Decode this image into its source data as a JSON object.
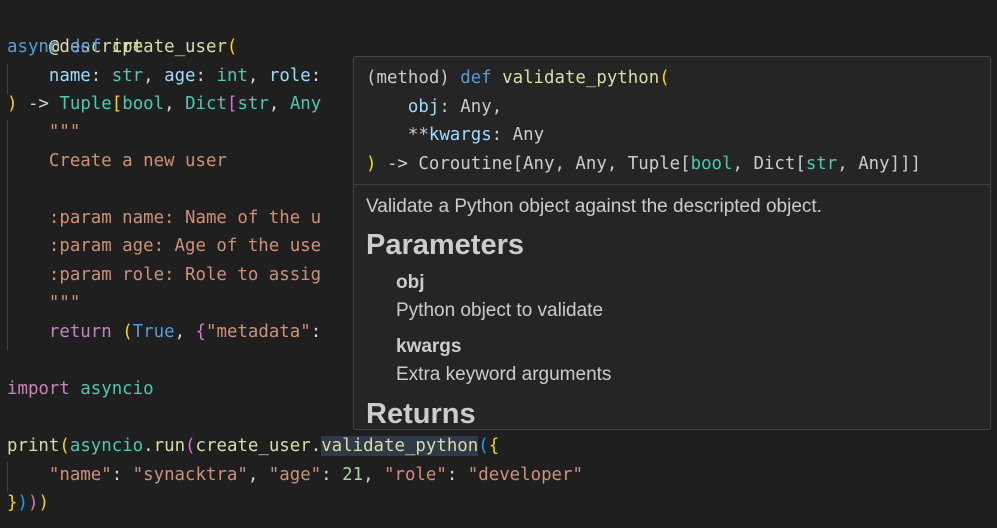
{
  "editor": {
    "decorator": "@descript",
    "l2": {
      "kw_async": "async",
      "kw_def": "def",
      "fn_name": "create_user",
      "open": "("
    },
    "l3": {
      "p1": "name",
      "c1": ": ",
      "t1": "str",
      "s1": ", ",
      "p2": "age",
      "c2": ": ",
      "t2": "int",
      "s2": ", ",
      "p3": "role",
      "c3": ":"
    },
    "l4": {
      "close": ")",
      "arrow": " -> ",
      "t_tuple": "Tuple",
      "lb": "[",
      "t_bool": "bool",
      "sep": ", ",
      "t_dict": "Dict",
      "lb2": "[",
      "t_str": "str",
      "sep2": ", ",
      "t_any": "Any"
    },
    "doc_open": "\"\"\"",
    "doc_line1": "Create a new user",
    "doc_param1": ":param name: Name of the u",
    "doc_param2": ":param age: Age of the use",
    "doc_param3": ":param role: Role to assig",
    "doc_close": "\"\"\"",
    "ret": {
      "kw": "return",
      "sp": " ",
      "po": "(",
      "true": "True",
      "sep": ", ",
      "bo": "{",
      "key": "\"metadata\"",
      "colon": ":"
    },
    "imp": {
      "kw": "import",
      "mod": " asyncio"
    },
    "print": {
      "fn": "print",
      "p1": "(",
      "mod": "asyncio",
      "dot": ".",
      "run": "run",
      "p2": "(",
      "cu": "create_user",
      "dot2": ".",
      "vp": "validate_python",
      "p3": "(",
      "brace": "{"
    },
    "dict_line": {
      "k1": "\"name\"",
      "c1": ": ",
      "v1": "\"synacktra\"",
      "s1": ", ",
      "k2": "\"age\"",
      "c2": ": ",
      "v2": "21",
      "s2": ", ",
      "k3": "\"role\"",
      "c3": ": ",
      "v3": "\"developer\""
    },
    "end": {
      "b": "}",
      "p3": ")",
      "p2": ")",
      "p1": ")"
    }
  },
  "hover": {
    "sig1": {
      "tag": "(method) ",
      "kw": "def",
      "name": " validate_python",
      "open": "("
    },
    "sig2": {
      "indent": "    ",
      "param": "obj",
      "colon": ": ",
      "type": "Any",
      "comma": ","
    },
    "sig3": {
      "indent": "    ",
      "stars": "**",
      "param": "kwargs",
      "colon": ": ",
      "type": "Any"
    },
    "sig4": {
      "close": ")",
      "arrow": " -> ",
      "coro": "Coroutine",
      "rest": "[Any, Any, Tuple[",
      "bool": "bool",
      "sep": ", ",
      "dict": "Dict",
      "lb": "[",
      "str": "str",
      "tail": ", Any]]]"
    },
    "description": "Validate a Python object against the descripted object.",
    "params_heading": "Parameters",
    "params": [
      {
        "name": "obj",
        "desc": "Python object to validate"
      },
      {
        "name": "kwargs",
        "desc": "Extra keyword arguments"
      }
    ],
    "returns_heading": "Returns"
  },
  "colors": {
    "background": "#1f1f1f",
    "keyword": "#569cd6",
    "function": "#dcdcaa",
    "type": "#4ec9b0",
    "string": "#ce9178",
    "hover_bg": "#252526"
  }
}
